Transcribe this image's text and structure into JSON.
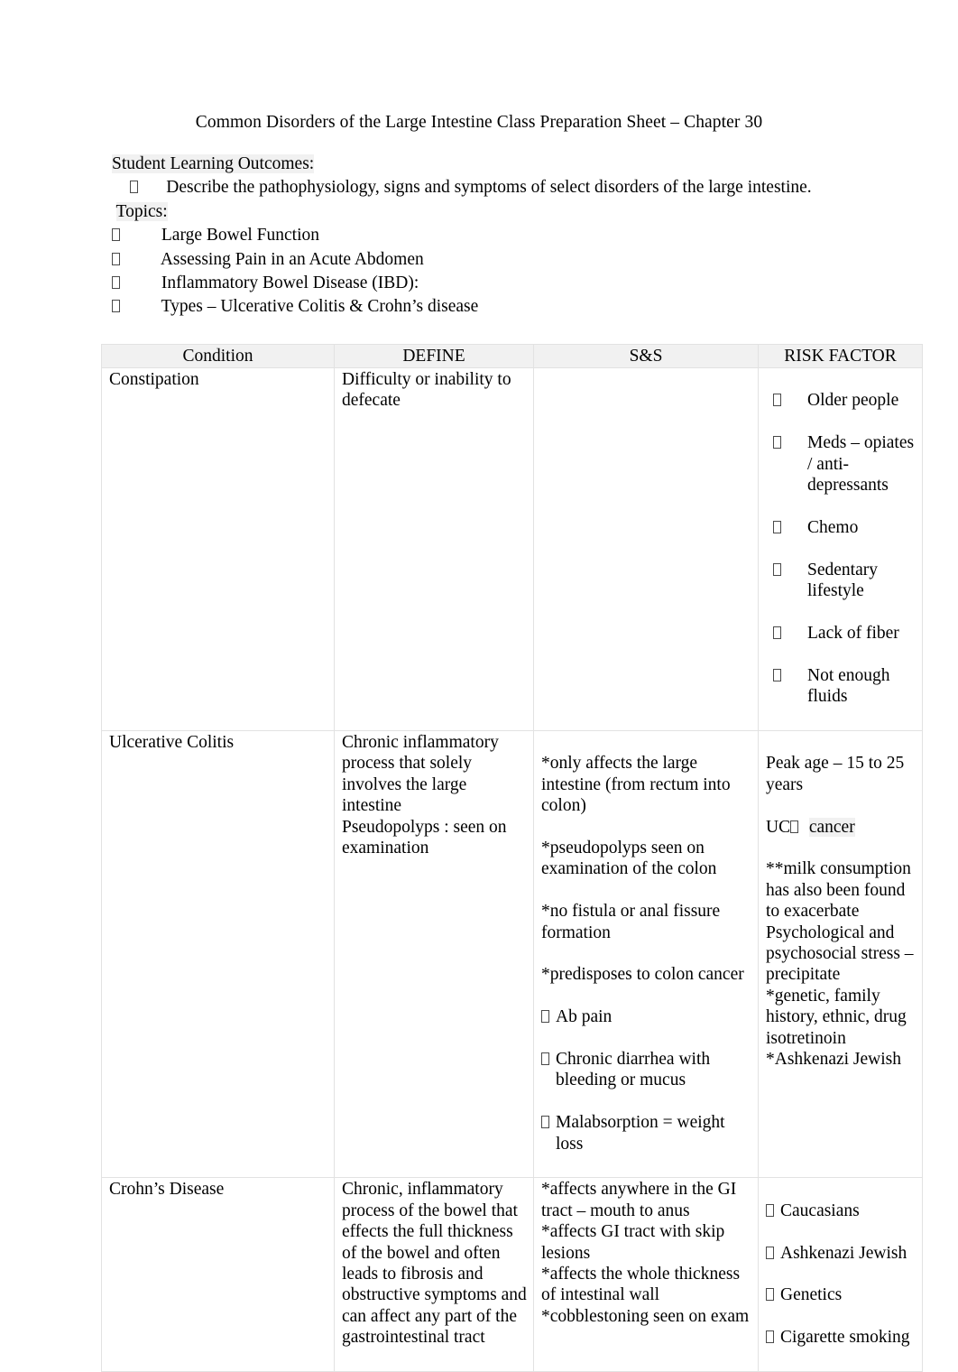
{
  "document": {
    "title": "Common Disorders of the Large Intestine Class Preparation Sheet – Chapter 30",
    "learning_outcomes_label": "Student Learning Outcomes:",
    "learning_outcomes": [
      "Describe the pathophysiology, signs and symptoms of select disorders of the large intestine."
    ],
    "topics_label": "Topics:",
    "topics": [
      "Large Bowel Function",
      "Assessing Pain in an Acute Abdomen",
      "Inflammatory Bowel Disease (IBD):",
      "Types – Ulcerative Colitis & Crohn’s disease"
    ]
  },
  "table": {
    "headers": {
      "condition": "Condition",
      "define": "DEFINE",
      "ss": "S&S",
      "risk": "RISK FACTOR"
    },
    "rows": [
      {
        "condition": "Constipation",
        "define": "Difficulty or inability to defecate",
        "ss": "",
        "risk_items": [
          "Older people",
          "Meds – opiates / anti-depressants",
          "Chemo",
          "Sedentary lifestyle",
          "Lack of fiber",
          "Not enough fluids"
        ]
      },
      {
        "condition": "Ulcerative Colitis",
        "define": "Chronic inflammatory process that solely involves the large intestine\nPseudopolyps : seen on examination",
        "ss_stars": [
          "*only affects the large intestine (from rectum into colon)",
          "*pseudopolyps seen on examination of the colon",
          "*no fistula or anal fissure formation",
          "*predisposes to colon cancer"
        ],
        "ss_bullets": [
          "Ab pain",
          "Chronic diarrhea with bleeding or mucus",
          "Malabsorption = weight loss"
        ],
        "risk_peak": "Peak age – 15 to 25 years",
        "risk_uc_prefix": "UC",
        "risk_uc_highlight": "cancer",
        "risk_rest": "**milk consumption has also been found to exacerbate\nPsychological and psychosocial stress – precipitate\n*genetic, family history, ethnic, drug isotretinoin\n*Ashkenazi Jewish"
      },
      {
        "condition": "Crohn’s Disease",
        "define": "Chronic, inflammatory process of the bowel that effects the full thickness of the bowel and often leads to fibrosis and obstructive symptoms and can affect any part of the gastrointestinal tract",
        "ss": "*affects anywhere in the GI tract –  mouth to anus\n*affects GI tract with skip lesions\n*affects the whole thickness of intestinal wall\n*cobblestoning  seen on exam",
        "risk_items": [
          "Caucasians",
          "Ashkenazi Jewish",
          "Genetics",
          "Cigarette smoking"
        ]
      }
    ]
  },
  "colors": {
    "highlight": "#f1f1f1",
    "border": "#e2e2e2",
    "text": "#000000"
  }
}
